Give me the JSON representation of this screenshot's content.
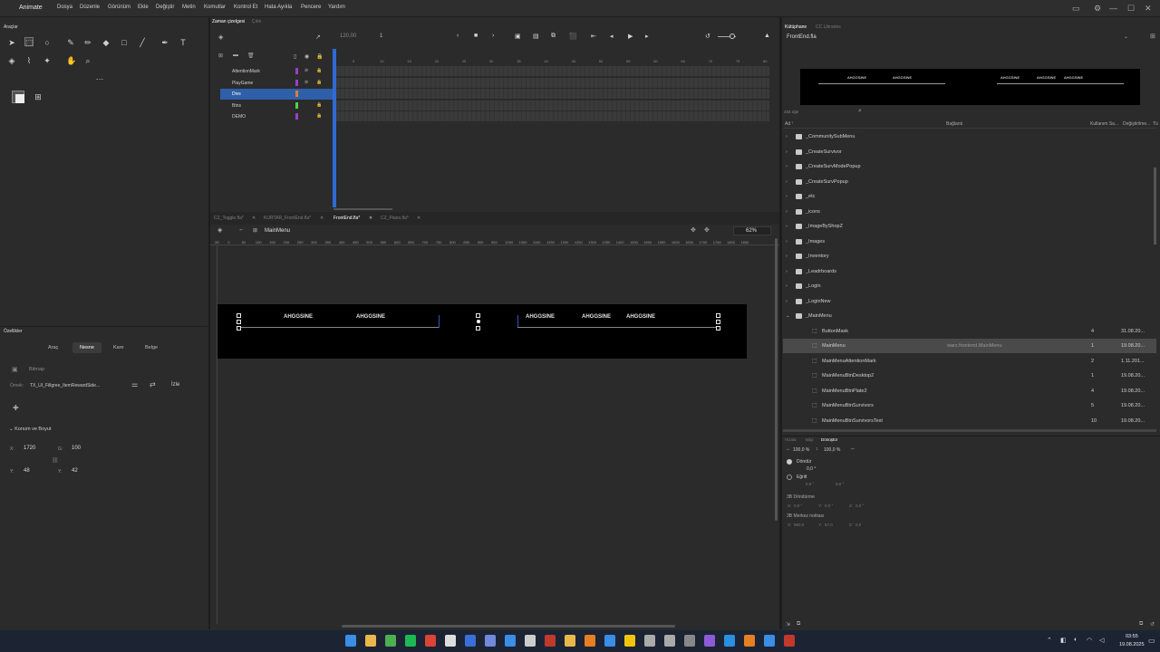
{
  "menu": {
    "app": "Animate",
    "items": [
      "Dosya",
      "Düzenle",
      "Görünüm",
      "Ekle",
      "Değiştir",
      "Metin",
      "Komutlar",
      "Kontrol Et",
      "Hata Ayıkla",
      "Pencere",
      "Yardım"
    ]
  },
  "tools": {
    "title": "Araçlar"
  },
  "timeline": {
    "tab": "Zaman çizelgesi",
    "tab2": "Çıktı",
    "fps": "120,00",
    "frame": "1",
    "layers": [
      {
        "name": "AttentionMark",
        "color": "#9b3fc4"
      },
      {
        "name": "PlayGame",
        "color": "#9b3fc4"
      },
      {
        "name": "Divs",
        "color": "#e07a3a"
      },
      {
        "name": "Btns",
        "color": "#4fd14f"
      },
      {
        "name": "DEMO",
        "color": "#9b3fc4"
      }
    ],
    "ticks": [
      "5",
      "10",
      "15",
      "20",
      "25",
      "30",
      "35",
      "40",
      "45",
      "50",
      "55",
      "60",
      "65",
      "70",
      "75",
      "80"
    ]
  },
  "docs": {
    "tabs": [
      "CZ_Toggle.fla*",
      "KURTAR_FrontEnd.fla*",
      "FrontEnd.fla*",
      "CZ_Piano.fla*"
    ],
    "active": 2
  },
  "stage": {
    "symbol": "MainMenu",
    "zoom": "62%",
    "ruler": [
      "-50",
      "0",
      "50",
      "100",
      "150",
      "200",
      "250",
      "300",
      "350",
      "400",
      "450",
      "500",
      "550",
      "600",
      "650",
      "700",
      "750",
      "800",
      "850",
      "900",
      "950",
      "1000",
      "1050",
      "1100",
      "1150",
      "1200",
      "1250",
      "1300",
      "1350",
      "1400",
      "1450",
      "1500",
      "1550",
      "1600",
      "1650",
      "1700",
      "1750",
      "1800",
      "1850"
    ],
    "labels": [
      "AHGGSINE",
      "AHGGSINE",
      "AHGGSINE",
      "AHGGSINE",
      "AHGGSINE"
    ]
  },
  "properties": {
    "title": "Özellikler",
    "tabs": [
      "Araç",
      "Nesne",
      "Kare",
      "Belge"
    ],
    "active_tab": 1,
    "type": "Bitmap",
    "instance_label": "Örnek:",
    "instance": "TX_UI_Fillgree_ItemRewardSide...",
    "swap": "İzle",
    "section": "Konum ve Boyut",
    "x": "1720",
    "y": "48",
    "w": "100",
    "h": "42"
  },
  "library": {
    "tab": "Kütüphane",
    "tab2": "CC Libraries",
    "file": "FrontEnd.fla",
    "preview_labels": [
      "AHGGSINE",
      "AHGGSINE",
      "AHGGSINE",
      "AHGGSINE",
      "AHGGSINE"
    ],
    "count": "234 öğe",
    "cols": {
      "name": "Ad",
      "linkage": "Bağlantı",
      "uses": "Kullanım Sa...",
      "modified": "Değiştirilme...",
      "type": "Tü"
    },
    "items": [
      {
        "name": "_CommunitySubMenu",
        "kind": "folder",
        "level": 0
      },
      {
        "name": "_CreateSurvivor",
        "kind": "folder",
        "level": 0
      },
      {
        "name": "_CreateSurvModePopup",
        "kind": "folder",
        "level": 0
      },
      {
        "name": "_CreateSurvPopup",
        "kind": "folder",
        "level": 0
      },
      {
        "name": "_etc",
        "kind": "folder",
        "level": 0
      },
      {
        "name": "_icons",
        "kind": "folder",
        "level": 0
      },
      {
        "name": "_ImageByShopZ",
        "kind": "folder",
        "level": 0
      },
      {
        "name": "_Images",
        "kind": "folder",
        "level": 0
      },
      {
        "name": "_Inventory",
        "kind": "folder",
        "level": 0
      },
      {
        "name": "_Leadrboards",
        "kind": "folder",
        "level": 0
      },
      {
        "name": "_Login",
        "kind": "folder",
        "level": 0
      },
      {
        "name": "_LoginNew",
        "kind": "folder",
        "level": 0
      },
      {
        "name": "_MainMenu",
        "kind": "folder-open",
        "level": 0
      },
      {
        "name": "ButtonMask",
        "kind": "symbol",
        "level": 1,
        "uses": "4",
        "date": "31.08.20..."
      },
      {
        "name": "MainMenu",
        "kind": "symbol",
        "level": 1,
        "linkage": "warz.frontend.MainMenu",
        "uses": "1",
        "date": "19.08.20...",
        "selected": true
      },
      {
        "name": "MainMenuAttentionMark",
        "kind": "symbol",
        "level": 1,
        "uses": "2",
        "date": "1.11.201..."
      },
      {
        "name": "MainMenuBtnDesktop2",
        "kind": "symbol",
        "level": 1,
        "uses": "1",
        "date": "19.08.20..."
      },
      {
        "name": "MainMenuBtnPlate2",
        "kind": "symbol",
        "level": 1,
        "uses": "4",
        "date": "19.08.20..."
      },
      {
        "name": "MainMenuBtnSurvivors",
        "kind": "symbol",
        "level": 1,
        "uses": "5",
        "date": "19.08.20..."
      },
      {
        "name": "MainMenuBtnSurvivorsText",
        "kind": "symbol",
        "level": 1,
        "uses": "10",
        "date": "19.08.20..."
      }
    ]
  },
  "transform": {
    "tabs": [
      "Hizala",
      "Bilgi",
      "Dönüştür"
    ],
    "sx": "100,0 %",
    "sy": "100,0 %",
    "rotate": "Döndür",
    "rot_val": "0,0 °",
    "skew": "Eğrilt",
    "skew_a": "0,0 °",
    "skew_b": "0,0 °",
    "rot3d": "3B Döndürme",
    "rx": "0,0 °",
    "ry": "0,0 °",
    "rz": "0,0 °",
    "center3d": "3B Merkez noktası",
    "cx": "960,0",
    "cy": "57,0",
    "cz": "0,0",
    "lbl_x": "X:",
    "lbl_y": "Y:",
    "lbl_z": "Z:"
  },
  "taskbar": {
    "time": "03:55",
    "date": "19.08.2025"
  },
  "colors": {
    "accent": "#2f5fa8",
    "bg": "#2b2b2b",
    "stage": "#000000"
  }
}
